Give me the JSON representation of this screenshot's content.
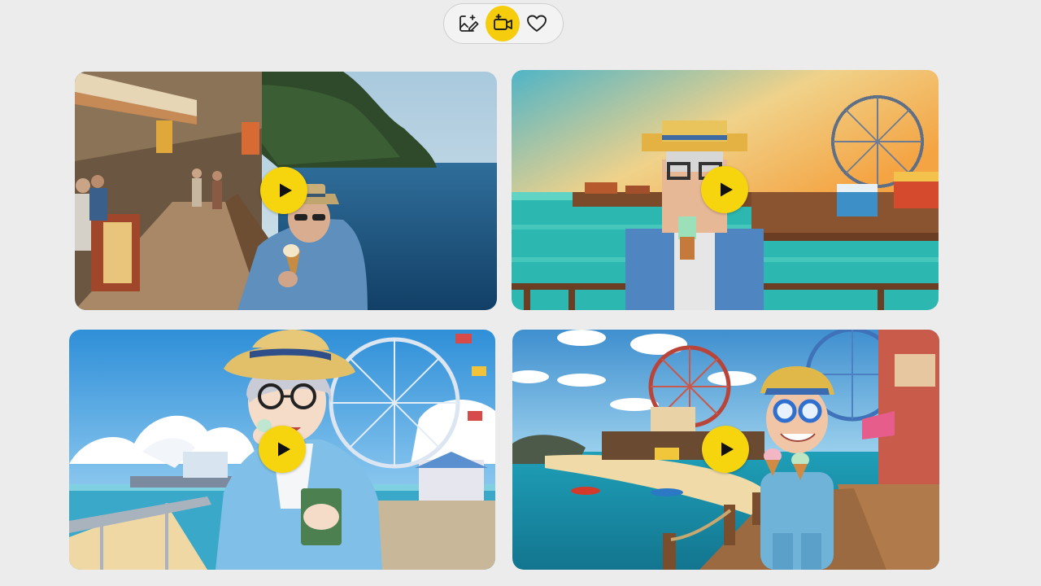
{
  "toolbar": {
    "buttons": [
      {
        "id": "image-edit",
        "icon": "image-edit-icon",
        "active": false
      },
      {
        "id": "video",
        "icon": "video-camera-icon",
        "active": true
      },
      {
        "id": "favorites",
        "icon": "heart-icon",
        "active": false
      }
    ],
    "accent_color": "#f6cd0c"
  },
  "gallery": {
    "cards": [
      {
        "style": "photorealistic",
        "play_icon": "play-icon"
      },
      {
        "style": "pixel-art",
        "play_icon": "play-icon"
      },
      {
        "style": "anime",
        "play_icon": "play-icon"
      },
      {
        "style": "3d-cartoon",
        "play_icon": "play-icon"
      }
    ],
    "play_button_color": "#f6d40e"
  }
}
